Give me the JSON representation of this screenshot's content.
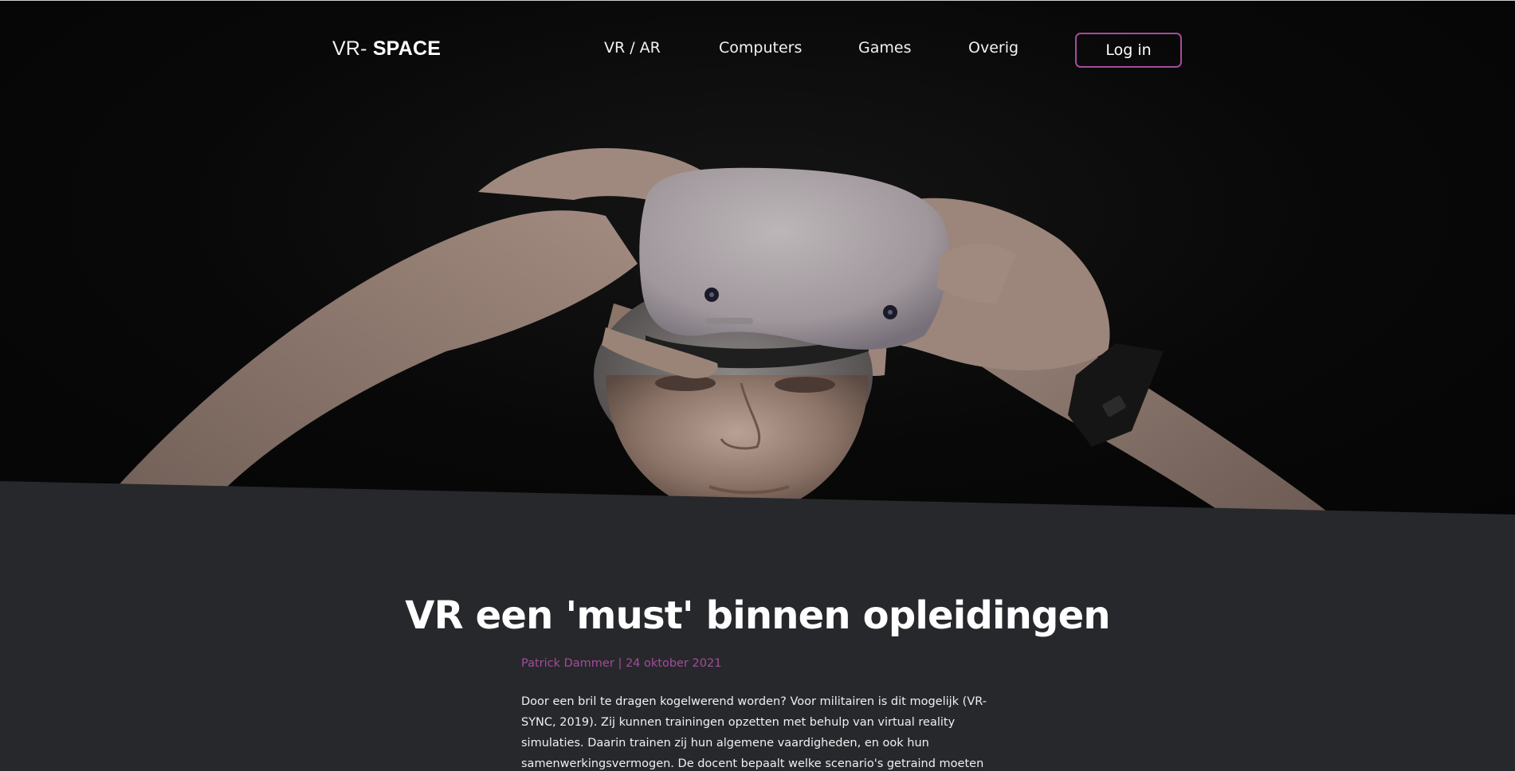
{
  "brand": {
    "prefix": "VR- ",
    "name": "SPACE"
  },
  "nav": {
    "items": [
      {
        "label": "VR / AR"
      },
      {
        "label": "Computers"
      },
      {
        "label": "Games"
      },
      {
        "label": "Overig"
      }
    ],
    "login_label": "Log in"
  },
  "hero": {
    "image": "person-wearing-vr-headset-photo"
  },
  "article": {
    "title": "VR een 'must' binnen opleidingen",
    "author": "Patrick Dammer",
    "separator": "|",
    "date": "24 oktober 2021",
    "paragraph": "Door een bril te dragen kogelwerend worden? Voor militairen is dit mogelijk (VR-SYNC, 2019). Zij kunnen trainingen opzetten met behulp van virtual reality simulaties. Daarin trainen zij hun algemene vaardigheden, en ook hun samenwerkingsvermogen. De docent bepaalt welke scenario's getraind moeten worden en de leerlingen ervaren een"
  },
  "colors": {
    "accent": "#a64b9c",
    "content_bg": "#27282b",
    "hero_bg": "#070707"
  }
}
